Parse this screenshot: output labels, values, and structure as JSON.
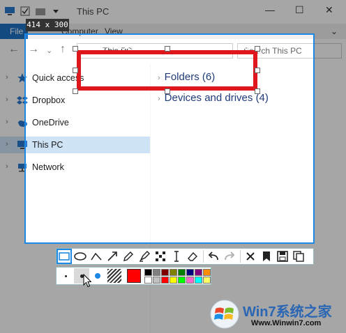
{
  "window": {
    "title": "This PC",
    "ribbon_tabs": [
      "File",
      "Computer",
      "View"
    ],
    "address": "This PC",
    "search_placeholder": "Search This PC"
  },
  "nav": {
    "items": [
      {
        "label": "Quick access",
        "icon": "star-icon",
        "selected": false
      },
      {
        "label": "Dropbox",
        "icon": "dropbox-icon",
        "selected": false
      },
      {
        "label": "OneDrive",
        "icon": "cloud-icon",
        "selected": false
      },
      {
        "label": "This PC",
        "icon": "computer-icon",
        "selected": true
      },
      {
        "label": "Network",
        "icon": "network-icon",
        "selected": false
      }
    ]
  },
  "content": {
    "groups": [
      {
        "label": "Folders (6)"
      },
      {
        "label": "Devices and drives (4)"
      }
    ]
  },
  "capture": {
    "size_label": "414 x 300",
    "border_color": "#1e88e5",
    "annotation_color": "#e0161d"
  },
  "toolbar": {
    "tools": [
      "rectangle-icon",
      "ellipse-icon",
      "polyline-icon",
      "arrow-icon",
      "pencil-icon",
      "highlighter-icon",
      "mosaic-icon",
      "text-cursor-icon",
      "eraser-icon",
      "undo-icon",
      "redo-icon",
      "close-icon",
      "pin-icon",
      "save-icon",
      "copy-icon"
    ],
    "active_tool": "rectangle-icon",
    "brush_sizes": [
      "small",
      "medium",
      "large"
    ],
    "selected_size": "medium",
    "main_color": "#ff0000",
    "palette": [
      "#000000",
      "#808080",
      "#800000",
      "#808000",
      "#008000",
      "#000080",
      "#800080",
      "#ff8c00",
      "#ffffff",
      "#c0c0c0",
      "#ff0000",
      "#ffff00",
      "#00ff00",
      "#ff66cc",
      "#00ffff",
      "#ffff66"
    ]
  },
  "watermark": {
    "title": "Win7系统之家",
    "url": "Www.Winwin7.com"
  }
}
